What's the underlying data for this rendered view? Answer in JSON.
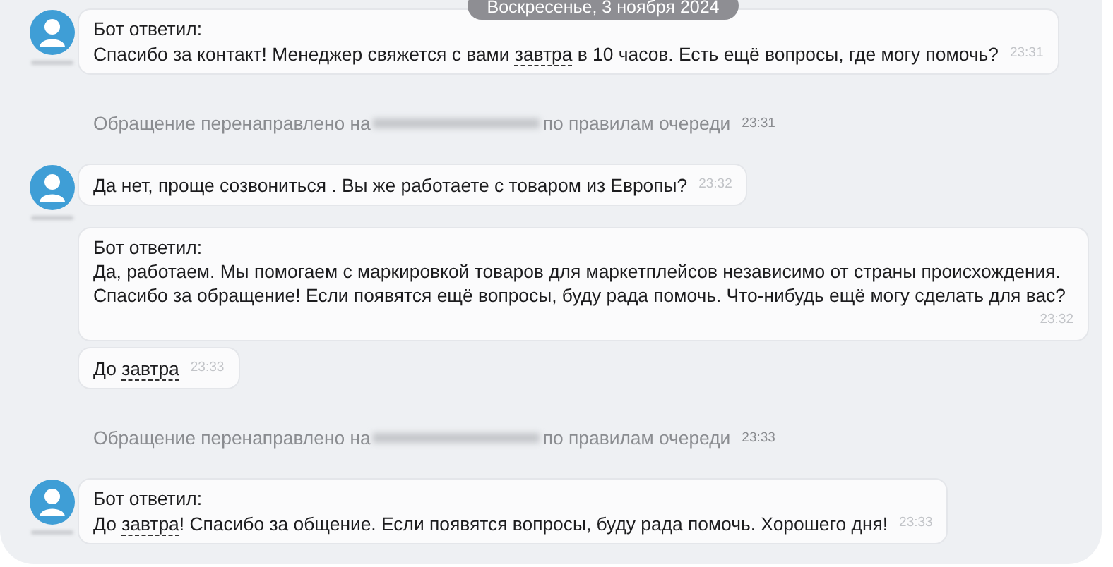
{
  "date_badge": "Воскресенье, 3 ноября 2024",
  "entries": [
    {
      "kind": "message",
      "avatar": true,
      "sender": "Бот ответил:",
      "lines": [
        [
          {
            "text": "Спасибо за контакт! Менеджер свяжется с вами ",
            "dotted": false
          },
          {
            "text": "завтра",
            "dotted": true
          },
          {
            "text": " в 10 часов. Есть ещё вопросы, где могу помочь?",
            "dotted": false
          }
        ]
      ],
      "time": "23:31"
    },
    {
      "kind": "system",
      "before": "Обращение перенаправлено на",
      "after": "по правилам очереди",
      "time": "23:31"
    },
    {
      "kind": "message",
      "avatar": true,
      "lines": [
        [
          {
            "text": "Да нет, проще созвониться . Вы же работаете с товаром из Европы?",
            "dotted": false
          }
        ]
      ],
      "time": "23:32"
    },
    {
      "kind": "message",
      "avatar": false,
      "sender": "Бот ответил:",
      "lines": [
        [
          {
            "text": "Да, работаем. Мы помогаем с маркировкой товаров для маркетплейсов независимо от страны происхождения.",
            "dotted": false
          }
        ],
        [
          {
            "text": "Спасибо за обращение! Если появятся ещё вопросы, буду рада помочь. Что-нибудь ещё могу сделать для вас?",
            "dotted": false
          }
        ]
      ],
      "time": "23:32"
    },
    {
      "kind": "message",
      "avatar": false,
      "lines": [
        [
          {
            "text": "До ",
            "dotted": false
          },
          {
            "text": "завтра",
            "dotted": true
          }
        ]
      ],
      "time": "23:33"
    },
    {
      "kind": "system",
      "before": "Обращение перенаправлено на",
      "after": "по правилам очереди",
      "time": "23:33"
    },
    {
      "kind": "message",
      "avatar": true,
      "sender": "Бот ответил:",
      "lines": [
        [
          {
            "text": "До ",
            "dotted": false
          },
          {
            "text": "завтра",
            "dotted": true
          },
          {
            "text": "! Спасибо за общение. Если появятся вопросы, буду рада помочь. Хорошего дня!",
            "dotted": false
          }
        ]
      ],
      "time": "23:33"
    }
  ]
}
